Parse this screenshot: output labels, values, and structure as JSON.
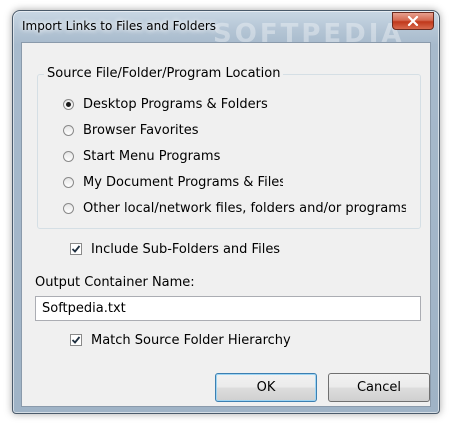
{
  "window": {
    "title": "Import Links to Files and Folders",
    "watermark": "SOFTPEDIA"
  },
  "source_group": {
    "legend": "Source File/Folder/Program Location",
    "options": [
      {
        "label": "Desktop Programs & Folders",
        "selected": true
      },
      {
        "label": "Browser Favorites",
        "selected": false
      },
      {
        "label": "Start Menu Programs",
        "selected": false
      },
      {
        "label": "My Document Programs & Files",
        "selected": false
      },
      {
        "label": "Other local/network files, folders and/or programs",
        "selected": false
      }
    ]
  },
  "include_subfolders": {
    "label": "Include Sub-Folders and Files",
    "checked": true
  },
  "output": {
    "label": "Output Container Name:",
    "value": "Softpedia.txt"
  },
  "match_hierarchy": {
    "label": "Match Source Folder Hierarchy",
    "checked": true
  },
  "buttons": {
    "ok": "OK",
    "cancel": "Cancel"
  },
  "icons": {
    "close": "close-icon",
    "check": "checkmark-icon"
  }
}
